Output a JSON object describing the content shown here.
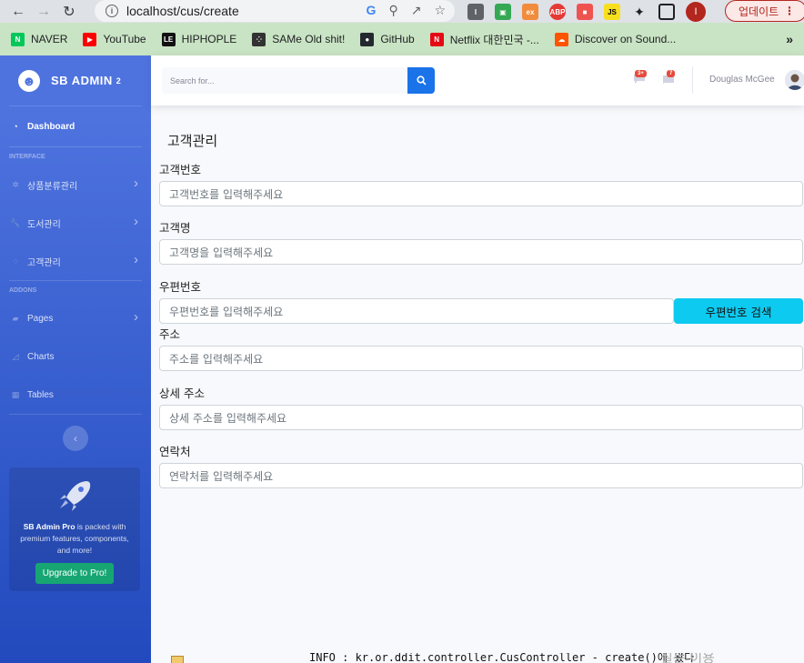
{
  "browser": {
    "url": "localhost/cus/create",
    "update_label": "업데이트",
    "profile_initial": "I"
  },
  "bookmarks": [
    {
      "label": "NAVER",
      "icon": "naver-icon",
      "color": "#03c75a"
    },
    {
      "label": "YouTube",
      "icon": "youtube-icon",
      "color": "#ff0000"
    },
    {
      "label": "HIPHOPLE",
      "icon": "hiphople-icon",
      "color": "#111111"
    },
    {
      "label": "SAMe Old shit!",
      "icon": "dots-icon",
      "color": "#333333"
    },
    {
      "label": "GitHub",
      "icon": "github-icon",
      "color": "#24292f"
    },
    {
      "label": "Netflix 대한민국 -...",
      "icon": "netflix-icon",
      "color": "#e50914"
    },
    {
      "label": "Discover on Sound...",
      "icon": "soundcloud-icon",
      "color": "#ff5500"
    }
  ],
  "sidebar": {
    "brand": "SB ADMIN",
    "brand_sup": "2",
    "dashboard": "Dashboard",
    "heading_interface": "INTERFACE",
    "heading_addons": "ADDONS",
    "items": [
      {
        "label": "상품분류관리",
        "icon": "cog-icon",
        "has_chevron": true
      },
      {
        "label": "도서관리",
        "icon": "wrench-icon",
        "has_chevron": true
      },
      {
        "label": "고객관리",
        "icon": "spinner-icon",
        "has_chevron": true
      },
      {
        "label": "Pages",
        "icon": "folder-icon",
        "has_chevron": true
      },
      {
        "label": "Charts",
        "icon": "chart-area-icon",
        "has_chevron": false
      },
      {
        "label": "Tables",
        "icon": "table-icon",
        "has_chevron": false
      }
    ],
    "promo": {
      "title": "SB Admin Pro",
      "text": "is packed with premium features, components, and more!",
      "button": "Upgrade to Pro!"
    }
  },
  "topbar": {
    "search_placeholder": "Search for...",
    "alerts_badge": "3+",
    "messages_badge": "7",
    "user_name": "Douglas McGee"
  },
  "form": {
    "title": "고객관리",
    "fields": [
      {
        "label": "고객번호",
        "placeholder": "고객번호를 입력해주세요"
      },
      {
        "label": "고객명",
        "placeholder": "고객명을 입력해주세요"
      },
      {
        "label": "우편번호",
        "placeholder": "우편번호를 입력해주세요"
      },
      {
        "label": "주소",
        "placeholder": "주소를 입력해주세요"
      },
      {
        "label": "상세 주소",
        "placeholder": "상세 주소를 입력해주세요"
      },
      {
        "label": "연락처",
        "placeholder": "연락처를 입력해주세요"
      }
    ],
    "zip_search_button": "우편번호 검색"
  },
  "console": {
    "text": "INFO : kr.or.ddit.controller.CusController - create()에 왔다",
    "ghost": "질문 이용"
  }
}
